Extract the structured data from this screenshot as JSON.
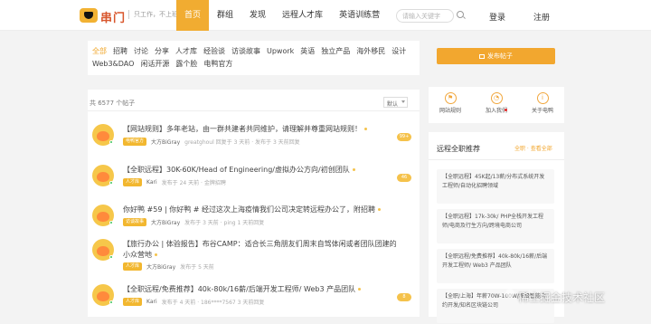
{
  "header": {
    "brand": "串门",
    "slogan": "只工作，不上班",
    "nav": [
      "首页",
      "群组",
      "发现",
      "远程人才库",
      "英语训练营"
    ],
    "search_placeholder": "请输入关键字",
    "login": "登录",
    "register": "注册"
  },
  "tags": [
    "全部",
    "招聘",
    "讨论",
    "分享",
    "人才库",
    "经验谈",
    "访谈故事",
    "Upwork",
    "英语",
    "独立产品",
    "海外移民",
    "设计",
    "Web3&DAO",
    "闲话开源",
    "露个脸",
    "电鸭官方"
  ],
  "list": {
    "count_text": "共 6577 个帖子",
    "sort": "默认",
    "posts": [
      {
        "title": "【网站规则】多年老站，由一群共建者共同维护，请理解并尊重网站规则！",
        "badge": "电鸭官方",
        "author": "大方BiGray",
        "meta": "greatghoul 回复于 3 天前 · 发布于 3 天前回复",
        "views": "102",
        "comments": "99+"
      },
      {
        "title": "【全职远程】30K-60K/Head of Engineering/虚拟办公方向/初创团队",
        "badge": "人才库",
        "author": "Kari",
        "meta": "发布于 24 天前 · 金牌招聘",
        "views": "",
        "comments": "46"
      },
      {
        "title": "你好鸭 #59 | 你好鸭 # 经过这次上海疫情我们公司决定转远程办公了，附招聘",
        "badge": "访谈故事",
        "author": "大方BiGray",
        "meta": "发布于 3 天前 · ping 1 天前回复",
        "views": "",
        "comments": ""
      },
      {
        "title": "【旅行办公 | 体验报告】布谷CAMP：适合长三角朋友们周末自驾体闲或者团队团建的小众营地",
        "badge": "人才库",
        "author": "大方BiGray",
        "meta": "发布于 5 天前",
        "views": "",
        "comments": ""
      },
      {
        "title": "【全职远程/免费推荐】40k-80k/16薪/后端开发工程师/ Web3 产品团队",
        "badge": "人才库",
        "author": "Kari",
        "meta": "发布于 4 天前 · 186****7567 3 天前回复",
        "views": "",
        "comments": "8"
      }
    ]
  },
  "sidebar": {
    "publish": "发布帖子",
    "quick": [
      "网站规则",
      "加入我们",
      "关于电鸭"
    ],
    "recommend_title": "远程全职推荐",
    "recommend_more": "全职 · 查看全部",
    "recommend": [
      "【全职远程】45K起/13薪/分布式系统开发工程师/自动化招聘领域",
      "【全职远程】17k-30k/ PHP全栈开发工程师/电商及行生方向/跨境电商公司",
      "【全职远程/免费推荐】40k-80k/16薪/后端开发工程师/ Web3 产品团队",
      "【全职/上海】年薪70W-100W/高级智能合约开发/知名区块链公司"
    ]
  },
  "watermark": "稀土掘金技术社区"
}
